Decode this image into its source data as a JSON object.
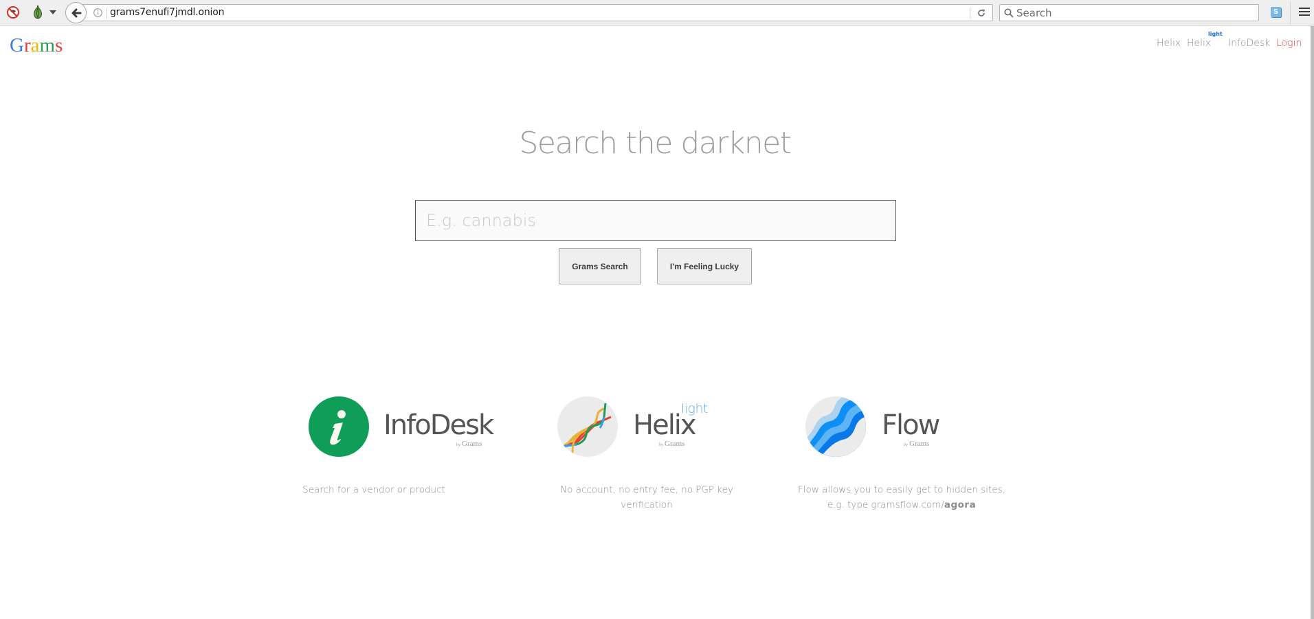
{
  "browser": {
    "url": "grams7enufi7jmdl.onion",
    "search_placeholder": "Search",
    "icons": [
      "noscript-icon",
      "tor-onion-icon",
      "dropdown-caret-icon",
      "back-arrow-icon",
      "info-icon",
      "reload-icon",
      "search-icon",
      "s-extension-icon",
      "hamburger-menu-icon"
    ]
  },
  "logo": {
    "letters": [
      {
        "char": "G",
        "color": "#3b7ddd"
      },
      {
        "char": "r",
        "color": "#e53935"
      },
      {
        "char": "a",
        "color": "#f5b400"
      },
      {
        "char": "m",
        "color": "#2e9d52"
      },
      {
        "char": "s",
        "color": "#e53935"
      }
    ]
  },
  "nav": {
    "items": [
      {
        "label": "Helix"
      },
      {
        "label": "Helix",
        "sup": "light"
      },
      {
        "label": "InfoDesk"
      },
      {
        "label": "Login"
      }
    ]
  },
  "hero": {
    "headline": "Search the darknet",
    "search_placeholder": "E.g. cannabis",
    "search_value": "",
    "buttons": {
      "search": "Grams Search",
      "lucky": "I'm Feeling Lucky"
    }
  },
  "features": [
    {
      "title": "InfoDesk",
      "byline_prefix": "by",
      "byline": "Grams",
      "description": "Search for a vendor or product",
      "icon": "info-icon",
      "color": "#0f9d58"
    },
    {
      "title": "Helix",
      "superscript": "light",
      "byline_prefix": "by",
      "byline": "Grams",
      "description_line1": "No account, no entry fee, no PGP key",
      "description_line2": "verification",
      "icon": "helix-dna-icon"
    },
    {
      "title": "Flow",
      "byline_prefix": "by",
      "byline": "Grams",
      "description_line1": "Flow allows you to easily get to hidden sites,",
      "description_line2_prefix": "e.g. type gramsflow.com/",
      "description_line2_bold": "agora",
      "icon": "flow-waves-icon"
    }
  ]
}
